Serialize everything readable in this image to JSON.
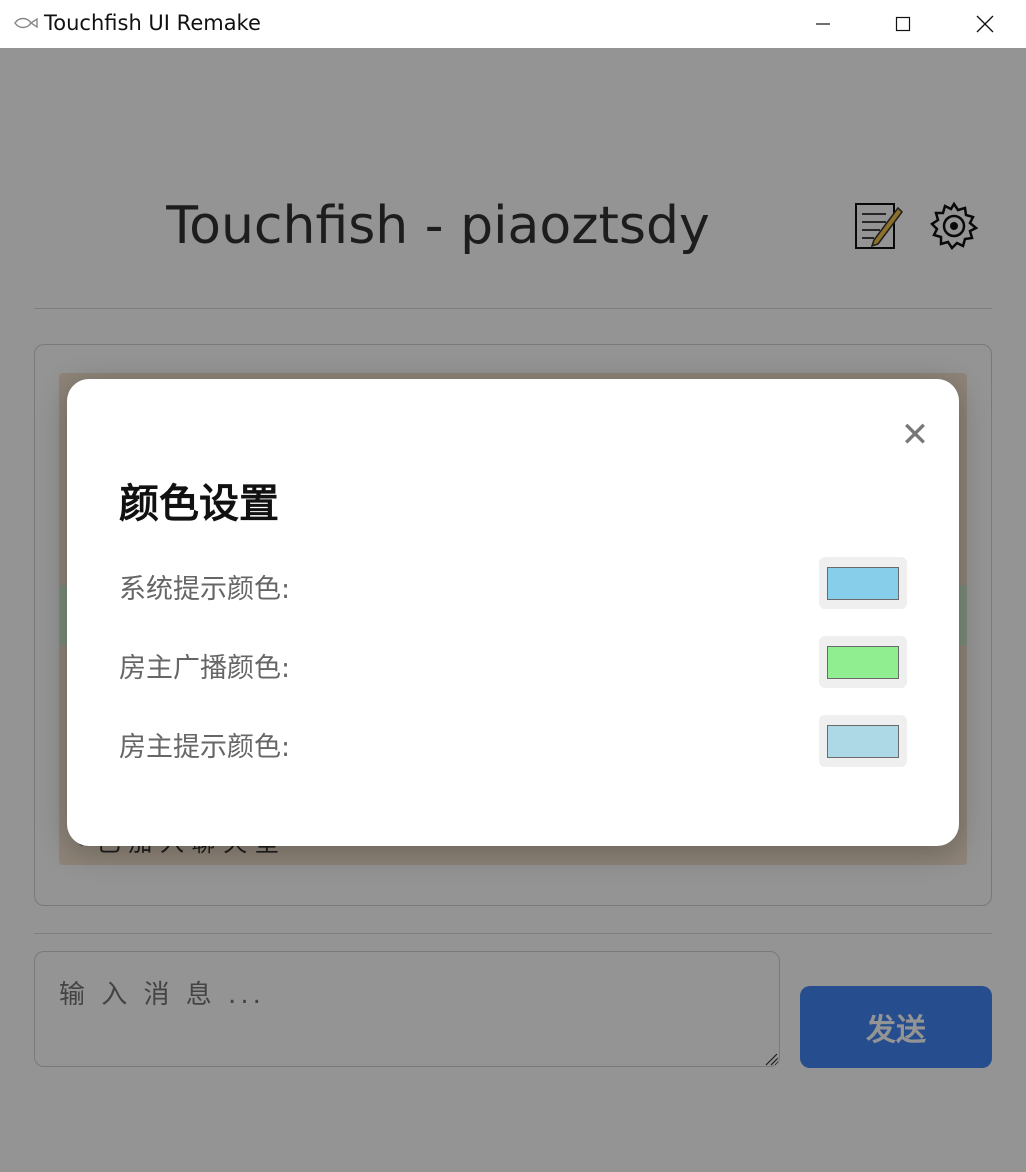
{
  "window": {
    "title": "Touchfish UI Remake",
    "app_icon": "fish-icon",
    "controls": [
      "minimize-icon",
      "maximize-icon",
      "close-icon"
    ]
  },
  "header": {
    "title": "Touchfish - piaoztsdy",
    "icons": [
      "memo-icon",
      "settings-gear-icon"
    ]
  },
  "chat": {
    "partial_text": "• 已 加 入 聊 天 室"
  },
  "composer": {
    "placeholder": "输 入 消 息 ...",
    "send_label": "发送",
    "send_color": "#4285f4"
  },
  "modal": {
    "title": "颜色设置",
    "close_label": "✕",
    "rows": [
      {
        "label": "系统提示颜色:",
        "color": "#87ceeb"
      },
      {
        "label": "房主广播颜色:",
        "color": "#90ee90"
      },
      {
        "label": "房主提示颜色:",
        "color": "#add8e6"
      }
    ]
  }
}
